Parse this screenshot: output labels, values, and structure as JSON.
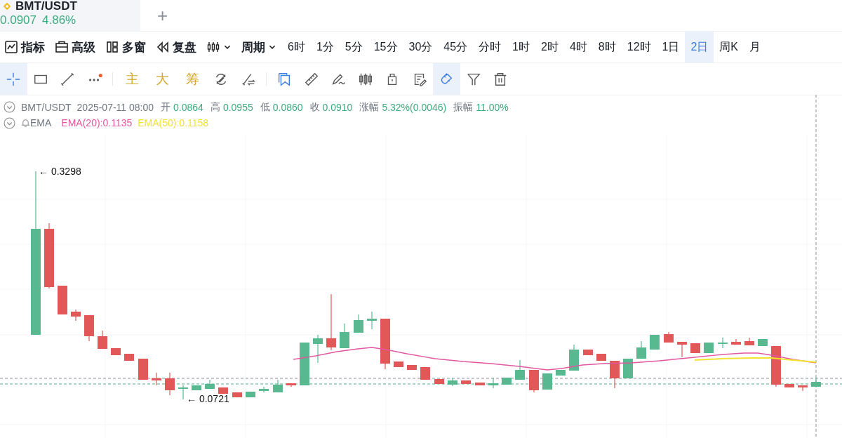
{
  "tabs": [
    {
      "symbol": "BMT/USDT",
      "price": "0.0907",
      "change": "4.86%",
      "selected": true
    }
  ],
  "add_tab": "+",
  "toolbar": [
    {
      "kind": "indicator",
      "label": "指标"
    },
    {
      "kind": "advanced",
      "label": "高级"
    },
    {
      "kind": "multi",
      "label": "多窗"
    },
    {
      "kind": "replay",
      "label": "复盘"
    },
    {
      "kind": "charttype"
    },
    {
      "kind": "period",
      "label": "周期"
    }
  ],
  "intervals": [
    {
      "label": "6时",
      "selected": false
    },
    {
      "label": "1分",
      "selected": false
    },
    {
      "label": "5分",
      "selected": false
    },
    {
      "label": "15分",
      "selected": false
    },
    {
      "label": "30分",
      "selected": false
    },
    {
      "label": "45分",
      "selected": false
    },
    {
      "label": "分时",
      "selected": false
    },
    {
      "label": "1时",
      "selected": false
    },
    {
      "label": "2时",
      "selected": false
    },
    {
      "label": "4时",
      "selected": false
    },
    {
      "label": "8时",
      "selected": false
    },
    {
      "label": "12时",
      "selected": false
    },
    {
      "label": "1日",
      "selected": false
    },
    {
      "label": "2日",
      "selected": true
    },
    {
      "label": "周K",
      "selected": false
    },
    {
      "label": "月",
      "selected": false
    }
  ],
  "drawing_tools": [
    {
      "kind": "crosshair",
      "selected": true
    },
    {
      "kind": "rect",
      "selected": false
    },
    {
      "kind": "line",
      "selected": false
    },
    {
      "kind": "more",
      "selected": false,
      "badge": true
    },
    {
      "kind": "divider"
    },
    {
      "kind": "text",
      "label": "主"
    },
    {
      "kind": "text",
      "label": "大"
    },
    {
      "kind": "text",
      "label": "筹"
    },
    {
      "kind": "rotate",
      "selected": false
    },
    {
      "kind": "swap",
      "selected": false
    },
    {
      "kind": "divider"
    },
    {
      "kind": "bookmark",
      "selected": false
    },
    {
      "kind": "ruler",
      "selected": false
    },
    {
      "kind": "pen",
      "selected": false
    },
    {
      "kind": "candles",
      "selected": false
    },
    {
      "kind": "lock",
      "selected": false
    },
    {
      "kind": "note",
      "selected": false
    },
    {
      "kind": "magnet",
      "selected": true
    },
    {
      "kind": "filter",
      "selected": false
    },
    {
      "kind": "trash",
      "selected": false
    }
  ],
  "legend": {
    "symbol": "BMT/USDT",
    "time": "2025-07-11 08:00",
    "fields": [
      {
        "label": "开",
        "value": "0.0864"
      },
      {
        "label": "高",
        "value": "0.0955"
      },
      {
        "label": "低",
        "value": "0.0860"
      },
      {
        "label": "收",
        "value": "0.0910"
      },
      {
        "label": "涨幅",
        "value": "5.32%(0.0046)"
      },
      {
        "label": "振幅",
        "value": "11.00%"
      }
    ]
  },
  "ema": {
    "label": "EMA",
    "series": [
      {
        "text": "EMA(20):0.1135",
        "color": "#e2579f"
      },
      {
        "text": "EMA(50):0.1158",
        "color": "#f2e330"
      }
    ]
  },
  "chart": {
    "high_label": "← 0.3298",
    "low_label": "← 0.0721"
  }
}
